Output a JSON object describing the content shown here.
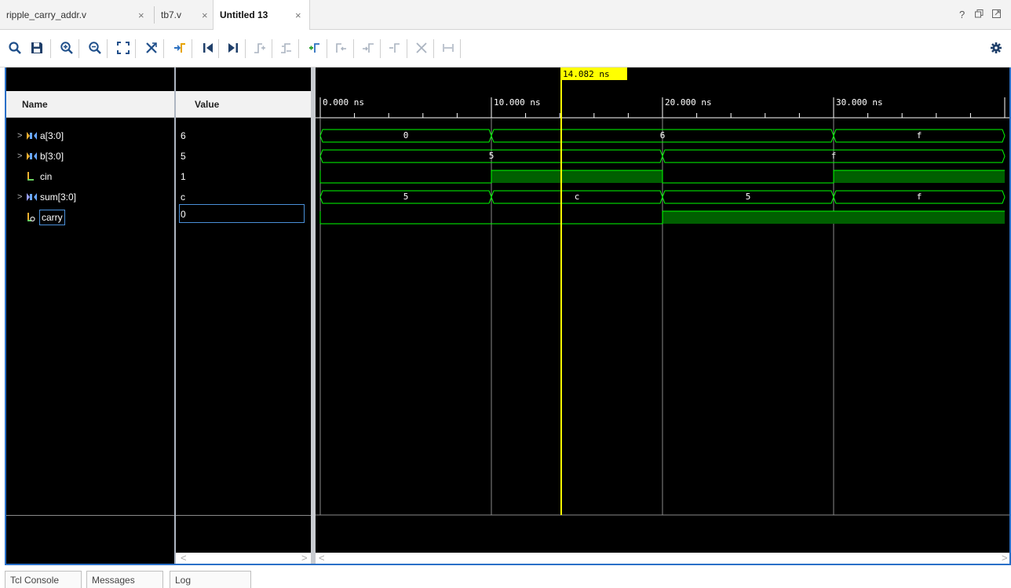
{
  "tabs": [
    {
      "label": "ripple_carry_addr.v",
      "active": false
    },
    {
      "label": "tb7.v",
      "active": false
    },
    {
      "label": "Untitled 13",
      "active": true
    }
  ],
  "tab_close_glyph": "×",
  "window_controls": {
    "help": "?",
    "restore": "🗗",
    "maximize": "🗖"
  },
  "toolbar": {
    "buttons": [
      "search-icon",
      "save-icon",
      "zoom-in-icon",
      "zoom-out-icon",
      "zoom-fit-icon",
      "swap-cursor-icon",
      "go-to-time-0-icon",
      "go-to-first-icon",
      "go-to-last-icon",
      "add-marker-icon",
      "previous-marker-icon",
      "next-marker-icon",
      "add-marker-green-icon",
      "prev-transition-icon",
      "next-transition-icon",
      "remove-marker-icon",
      "delete-icon",
      "snap-icon",
      "settings-gear-icon"
    ]
  },
  "waveform": {
    "columns": {
      "name": "Name",
      "value": "Value"
    },
    "cursor_time": "14.082 ns",
    "time_ticks": [
      "0.000 ns",
      "10.000 ns",
      "20.000 ns",
      "30.000 ns"
    ],
    "signals": [
      {
        "name": "a[3:0]",
        "value": "6",
        "type": "bus",
        "expandable": true
      },
      {
        "name": "b[3:0]",
        "value": "5",
        "type": "bus",
        "expandable": true
      },
      {
        "name": "cin",
        "value": "1",
        "type": "bit",
        "expandable": false
      },
      {
        "name": "sum[3:0]",
        "value": "c",
        "type": "bus",
        "expandable": true
      },
      {
        "name": "carry",
        "value": "0",
        "type": "bit",
        "expandable": false
      }
    ],
    "bus_segments": {
      "a": [
        "0",
        "6",
        "f"
      ],
      "b": [
        "5",
        "f"
      ],
      "sum": [
        "5",
        "c",
        "5",
        "f"
      ]
    },
    "colors": {
      "signal": "#00ff00",
      "cursor": "#ffff00",
      "background": "#000000",
      "high_fill": "#005f00"
    }
  },
  "scroll": {
    "left": "<",
    "right": ">"
  },
  "bottom_tabs": [
    "Tcl Console",
    "Messages",
    "Log"
  ]
}
